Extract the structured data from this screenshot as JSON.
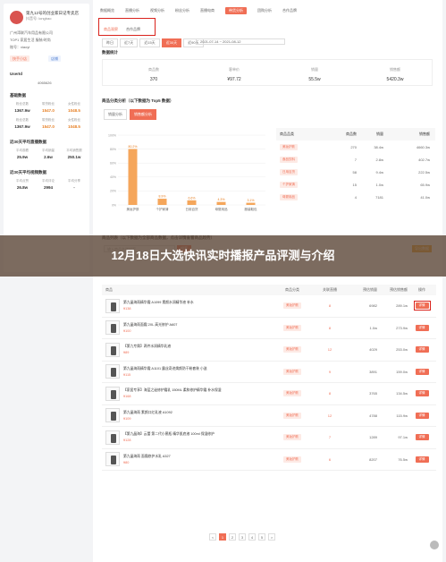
{
  "sidebar": {
    "name": "第九12号的创业家日记专卖店",
    "sub": "抖音号: longbao",
    "lines": [
      "广州湾联汽车用品有限公司",
      "TOP1 家居生活 服装/时尚",
      "账号：xiaoyi"
    ],
    "tags": [
      "快手小店",
      "店铺"
    ],
    "userid_label": "UserId",
    "userid_value": "4065626",
    "basic_title": "基础数据",
    "basic_cells": [
      {
        "label": "粉丝总数",
        "value": "1367.9w",
        "orange": false
      },
      {
        "label": "带货粉丝",
        "value": "1547.0",
        "orange": true
      },
      {
        "label": "女性粉丝",
        "value": "1048.5",
        "orange": true
      },
      {
        "label": "粉丝总数",
        "value": "1367.9w",
        "orange": false
      },
      {
        "label": "带货粉丝",
        "value": "1547.0",
        "orange": true
      },
      {
        "label": "女性粉丝",
        "value": "1048.5",
        "orange": true
      }
    ],
    "live30_title": "近30天平均直播数据",
    "live30_cells": [
      {
        "label": "平均观看",
        "value": "25.9w"
      },
      {
        "label": "平均销量",
        "value": "2.6w"
      },
      {
        "label": "平均销售额",
        "value": "250.1w"
      }
    ],
    "video30_title": "近30天平均视频数据",
    "video30_cells": [
      {
        "label": "平均点赞",
        "value": "26.8w"
      },
      {
        "label": "平均评论",
        "value": "2994"
      },
      {
        "label": "平均分享",
        "value": "-"
      }
    ]
  },
  "topnav": [
    "数据概览",
    "直播分析",
    "视频分析",
    "粉丝分析",
    "直播电商",
    "带货分析",
    "团购分析",
    "合作品牌"
  ],
  "topnav_active": 5,
  "subtabs": [
    "商品观察",
    "合作品牌"
  ],
  "filters": [
    "昨日",
    "近7天",
    "近15天",
    "近30天",
    "近90天"
  ],
  "filters_active": 3,
  "daterange": "2021-07-14  ~  2021-08-12",
  "overview_title": "数据统计",
  "overview": [
    {
      "label": "商品数",
      "value": "370"
    },
    {
      "label": "客单价",
      "value": "¥97.72"
    },
    {
      "label": "销量",
      "value": "55.5w"
    },
    {
      "label": "销售额",
      "value": "5420.3w"
    }
  ],
  "category_title": "商品分类分析（以下数据为 Top5 数据）",
  "category_tabs": [
    "销量分析",
    "销售额分析"
  ],
  "category_tabs_active": 1,
  "chart_data": {
    "type": "bar",
    "categories": [
      "美妆护肤",
      "个护家清",
      "日用百货",
      "母婴用品",
      "服装鞋包"
    ],
    "values": [
      80.2,
      8.9,
      6.6,
      4.3,
      3.1
    ],
    "data_labels": [
      "80.2%",
      "8.9%",
      "6.6%",
      "4.3%",
      "3.1%"
    ],
    "ylim": [
      0,
      100
    ],
    "yticks": [
      "100%",
      "80%",
      "60%",
      "40%",
      "20%",
      "0%"
    ],
    "bar_color": "#f5a65b"
  },
  "category_table": {
    "headers": [
      "商品品类",
      "商品数",
      "销量",
      "销售额"
    ],
    "rows": [
      [
        "美妆护肤",
        "270",
        "38.4w",
        "4660.3w"
      ],
      [
        "食品饮料",
        "7",
        "2.8w",
        "402.7w"
      ],
      [
        "日用百货",
        "58",
        "9.4w",
        "222.5w"
      ],
      [
        "个护家清",
        "15",
        "1.0w",
        "65.9w"
      ],
      [
        "母婴用品",
        "4",
        "7181",
        "41.0w"
      ]
    ]
  },
  "list_title": "商品列表（以下数据为全部商品数据，点击详情查看商品趋势）",
  "search_placeholder": "输入商品名称搜索",
  "search_btn": "搜索",
  "export_btn": "导出数据",
  "banner_text": "12月18日大选快讯实时播报产品评测与介绍",
  "product_table": {
    "headers": [
      "商品",
      "商品分类",
      "关联直播",
      "预估销量",
      "预估销售额",
      "操作"
    ],
    "rows": [
      {
        "title": "第九晶海雨精华霜 A1099 素颜水润精华液 补水",
        "price": "¥138",
        "cat": "美妆护肤",
        "live": "8",
        "sales": "6982",
        "amount": "289.1w"
      },
      {
        "title": "第九晶海雨面霜 2XL 高光修护 A607",
        "price": "¥100",
        "cat": "美妆护肤",
        "live": "8",
        "sales": "1.0w",
        "amount": "273.9w"
      },
      {
        "title": "【第九专属】两件水润精华乳液",
        "price": "¥89",
        "cat": "美妆护肤",
        "live": "12",
        "sales": "4029",
        "amount": "253.0w"
      },
      {
        "title": "第九晶海雨精华霜 A1101 露丝奇迹焕颜防干粉套装 小滋",
        "price": "¥115",
        "cat": "美妆护肤",
        "live": "9",
        "sales": "3891",
        "amount": "159.0w"
      },
      {
        "title": "【家居专享】海蓝之谜修护霜乳 150ML 柔和修护精华霜 补水保湿",
        "price": "¥168",
        "cat": "美妆护肤",
        "live": "8",
        "sales": "3765",
        "amount": "134.5w"
      },
      {
        "title": "第九晶海雨 素颜口红乳液 A1092",
        "price": "¥109",
        "cat": "美妆护肤",
        "live": "12",
        "sales": "4788",
        "amount": "115.9w"
      },
      {
        "title": "【第九晶海】云蕾 第二代小黑瓶 精华肌底液 100ml 保湿修护",
        "price": "¥128",
        "cat": "美妆护肤",
        "live": "7",
        "sales": "1289",
        "amount": "97.1w"
      },
      {
        "title": "第九晶海雨 面霜修护水乳 A327",
        "price": "¥80",
        "cat": "美妆护肤",
        "live": "6",
        "sales": "8207",
        "amount": "76.5w"
      }
    ],
    "detail_label": "详情"
  },
  "pager": [
    "<",
    "1",
    "2",
    "3",
    "4",
    "5",
    ">"
  ],
  "pager_active": 1,
  "colors": {
    "accent": "#f06e55",
    "highlight_box": "#d9221c",
    "export": "#f39c12"
  }
}
